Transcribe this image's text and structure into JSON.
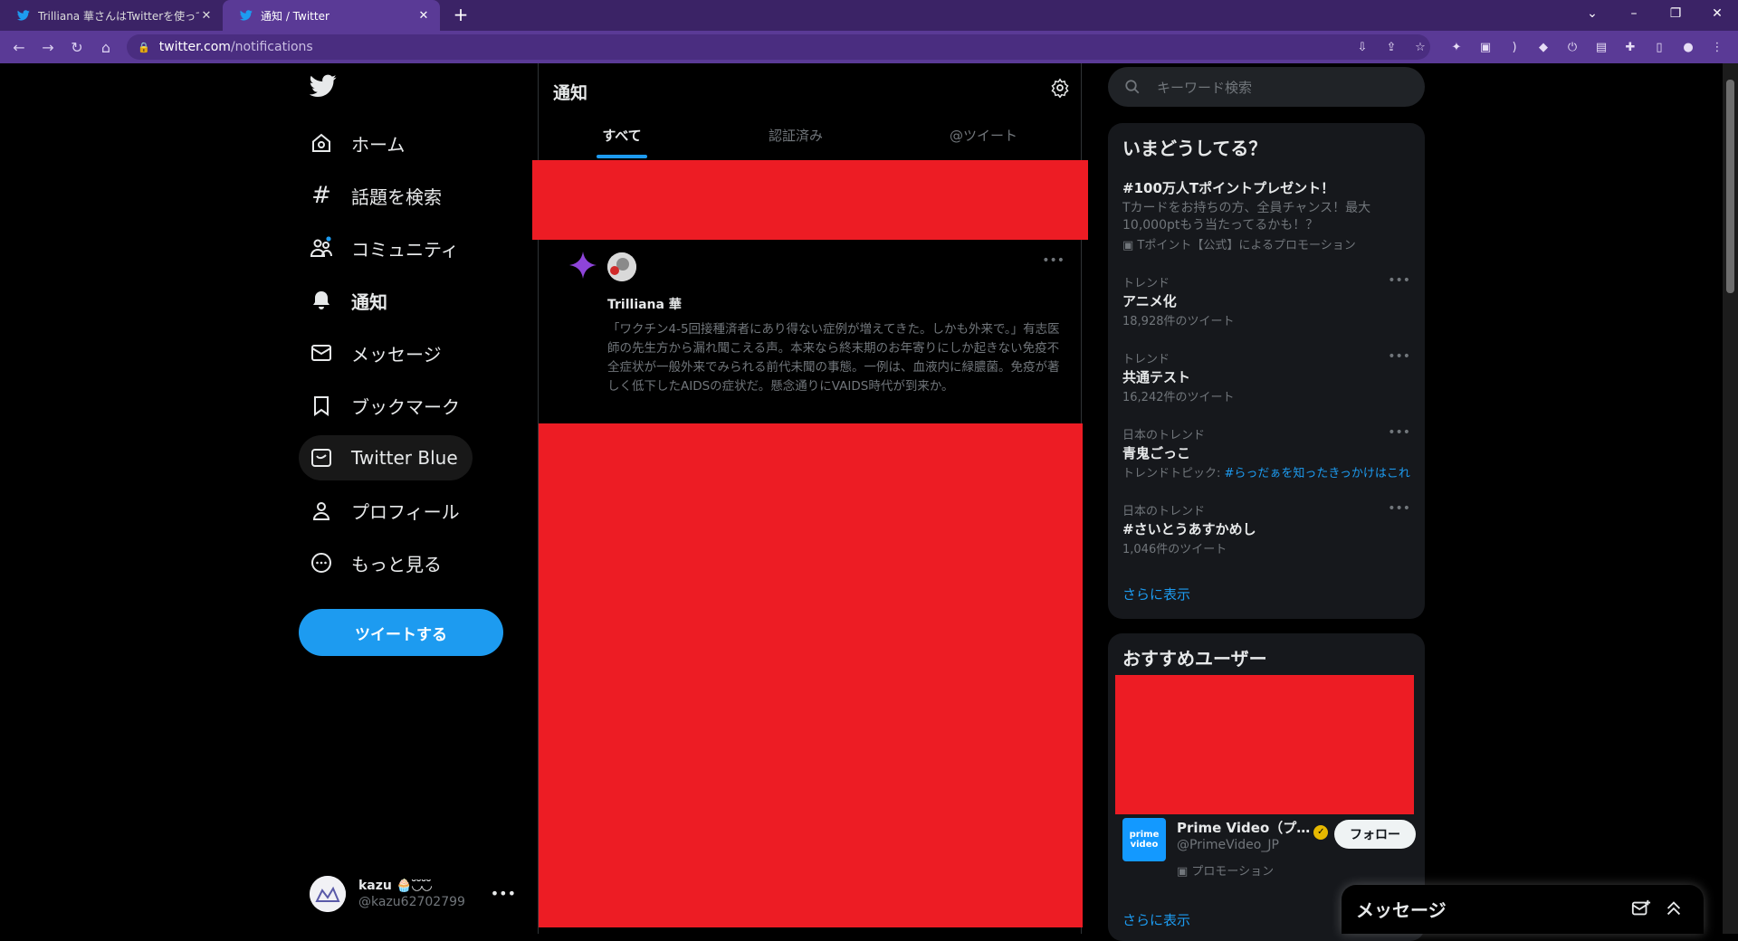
{
  "browser": {
    "tabs": [
      {
        "title": "Trilliana 華さんはTwitterを使ってい…",
        "active": false
      },
      {
        "title": "通知 / Twitter",
        "active": true
      }
    ],
    "url_host": "twitter.com",
    "url_path": "/notifications"
  },
  "nav": {
    "items": [
      {
        "label": "ホーム",
        "icon": "home-icon"
      },
      {
        "label": "話題を検索",
        "icon": "hashtag-icon"
      },
      {
        "label": "コミュニティ",
        "icon": "community-icon"
      },
      {
        "label": "通知",
        "icon": "bell-icon"
      },
      {
        "label": "メッセージ",
        "icon": "envelope-icon"
      },
      {
        "label": "ブックマーク",
        "icon": "bookmark-icon"
      },
      {
        "label": "Twitter Blue",
        "icon": "twitter-blue-icon"
      },
      {
        "label": "プロフィール",
        "icon": "person-icon"
      },
      {
        "label": "もっと見る",
        "icon": "more-circle-icon"
      }
    ],
    "tweet_button": "ツイートする",
    "account": {
      "name": "kazu 🧁◟̆◞̆◟̆◞̆",
      "handle": "@kazu62702799"
    }
  },
  "main": {
    "title": "通知",
    "tabs": [
      "すべて",
      "認証済み",
      "@ツイート"
    ],
    "tweet": {
      "author": "Trilliana 華",
      "text": "「ワクチン4-5回接種済者にあり得ない症例が増えてきた。しかも外来で。」有志医師の先生方から漏れ聞こえる声。本来なら終末期のお年寄りにしか起きない免疫不全症状が一般外来でみられる前代未聞の事態。一例は、血液内に緑膿菌。免疫が著しく低下したAIDSの症状だ。懸念通りにVAIDS時代が到来か。"
    }
  },
  "sidebar": {
    "search_placeholder": "キーワード検索",
    "trends_title": "いまどうしてる？",
    "promo": {
      "title": "#100万人Tポイントプレゼント！",
      "desc": "Tカードをお持ちの方、全員チャンス！最大10,000ptもう当たってるかも！？",
      "by": "Tポイント【公式】によるプロモーション"
    },
    "trends": [
      {
        "meta": "トレンド",
        "title": "アニメ化",
        "count": "18,928件のツイート"
      },
      {
        "meta": "トレンド",
        "title": "共通テスト",
        "count": "16,242件のツイート"
      },
      {
        "meta": "日本のトレンド",
        "title": "青鬼ごっこ",
        "topic_label": "トレンドトピック: ",
        "topic_link": "#らっだぁを知ったきっかけはこれ"
      },
      {
        "meta": "日本のトレンド",
        "title": "#さいとうあすかめし",
        "count": "1,046件のツイート"
      }
    ],
    "show_more": "さらに表示",
    "who_to_follow_title": "おすすめユーザー",
    "suggested_user": {
      "name": "Prime Video（プ…",
      "handle": "@PrimeVideo_JP",
      "promo": "プロモーション",
      "follow": "フォロー",
      "logo_line1": "prime",
      "logo_line2": "video"
    },
    "show_more_2": "さらに表示"
  },
  "dm": {
    "title": "メッセージ"
  },
  "colors": {
    "accent": "#1d9bf0",
    "redaction": "#ed1c24",
    "browser": "#5a3a96"
  }
}
